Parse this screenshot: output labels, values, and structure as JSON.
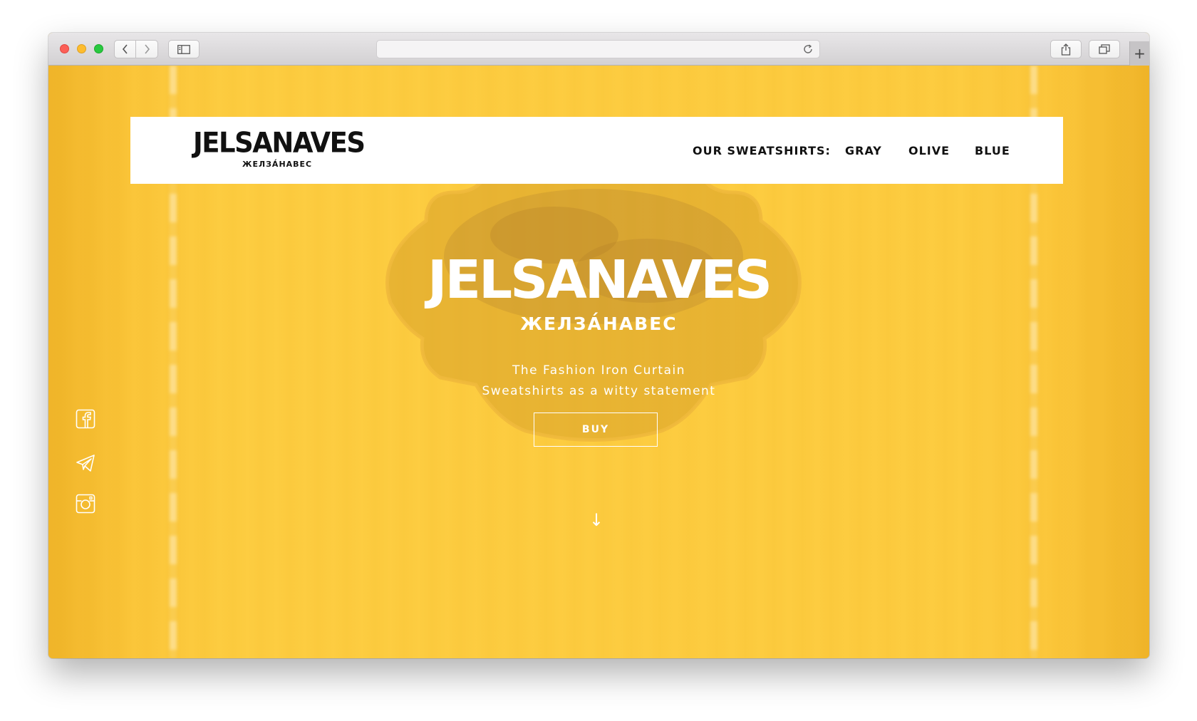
{
  "browser": {
    "back_icon": "chevron-left-icon",
    "forward_icon": "chevron-right-icon",
    "sidebar_icon": "sidebar-icon",
    "reload_icon": "reload-icon",
    "share_icon": "share-icon",
    "tabs_icon": "tabs-icon",
    "new_tab_label": "+"
  },
  "header": {
    "logo_main": "JELSANAVES",
    "logo_sub": "ЖЕЛЗА́НАВЕС",
    "nav_label": "OUR SWEATSHIRTS:",
    "nav": [
      {
        "label": "GRAY"
      },
      {
        "label": "OLIVE"
      },
      {
        "label": "BLUE"
      }
    ]
  },
  "hero": {
    "title": "JELSANAVES",
    "subtitle": "ЖЕЛЗА́НАВЕС",
    "tagline_1": "The Fashion Iron Curtain",
    "tagline_2": "Sweatshirts as a witty statement",
    "buy_label": "BUY",
    "scroll_arrow": "↓"
  },
  "social": [
    {
      "icon": "facebook-icon"
    },
    {
      "icon": "telegram-icon"
    },
    {
      "icon": "instagram-icon"
    }
  ],
  "colors": {
    "background": "#fdc93c",
    "header_bg": "#ffffff",
    "text_dark": "#111111",
    "text_light": "#ffffff"
  }
}
